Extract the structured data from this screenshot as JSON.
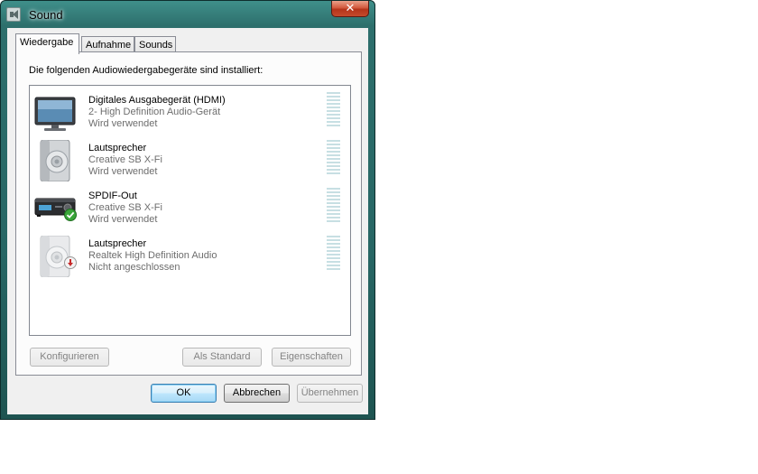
{
  "window": {
    "title": "Sound"
  },
  "tabs": [
    {
      "label": "Wiedergabe"
    },
    {
      "label": "Aufnahme"
    },
    {
      "label": "Sounds"
    }
  ],
  "panel": {
    "instruction": "Die folgenden Audiowiedergabegeräte sind installiert:"
  },
  "devices": [
    {
      "icon": "hdmi-monitor-icon",
      "name": "Digitales Ausgabegerät (HDMI)",
      "subtitle": "2- High Definition Audio-Gerät",
      "status": "Wird verwendet"
    },
    {
      "icon": "speaker-icon",
      "name": "Lautsprecher",
      "subtitle": "Creative SB X-Fi",
      "status": "Wird verwendet"
    },
    {
      "icon": "spdif-receiver-icon",
      "name": "SPDIF-Out",
      "subtitle": "Creative SB X-Fi",
      "status": "Wird verwendet"
    },
    {
      "icon": "speaker-disconnected-icon",
      "name": "Lautsprecher",
      "subtitle": "Realtek High Definition Audio",
      "status": "Nicht angeschlossen"
    }
  ],
  "buttons": {
    "configure": "Konfigurieren",
    "set_default": "Als Standard",
    "properties": "Eigenschaften",
    "ok": "OK",
    "cancel": "Abbrechen",
    "apply": "Übernehmen"
  },
  "colors": {
    "titlebar": "#2d6f6c",
    "close_button": "#c44a2c",
    "default_check": "#3aa63a",
    "unplugged_badge": "#c62a2a"
  }
}
